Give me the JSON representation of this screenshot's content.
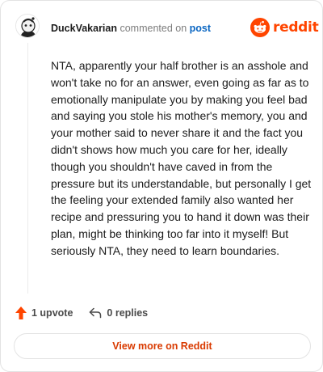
{
  "comment": {
    "username": "DuckVakarian",
    "action_text": "commented on",
    "post_link": "post",
    "body": "NTA, apparently your half brother is an asshole and won't take no for an answer, even going as far as to emotionally manipulate you by making you feel bad and saying you stole his mother's memory, you and your mother said to never share it and the fact you didn't shows how much you care for her, ideally though you shouldn't have caved in from the pressure but its understandable, but personally I get the feeling your extended family also wanted her recipe and pressuring you to hand it down was their plan, might be thinking too far into it myself! But seriously NTA, they need to learn boundaries."
  },
  "brand": {
    "name": "reddit",
    "color": "#ff4500"
  },
  "actions": {
    "upvotes": "1 upvote",
    "replies": "0 replies"
  },
  "footer": {
    "view_more": "View more on Reddit"
  },
  "colors": {
    "link": "#0a66c2",
    "accent": "#ff4500",
    "button_text": "#d93a00"
  },
  "icons": {
    "avatar": "snoo-avatar-icon",
    "logo": "reddit-snoo-icon",
    "upvote": "upvote-arrow-icon",
    "reply": "reply-arrow-icon"
  }
}
